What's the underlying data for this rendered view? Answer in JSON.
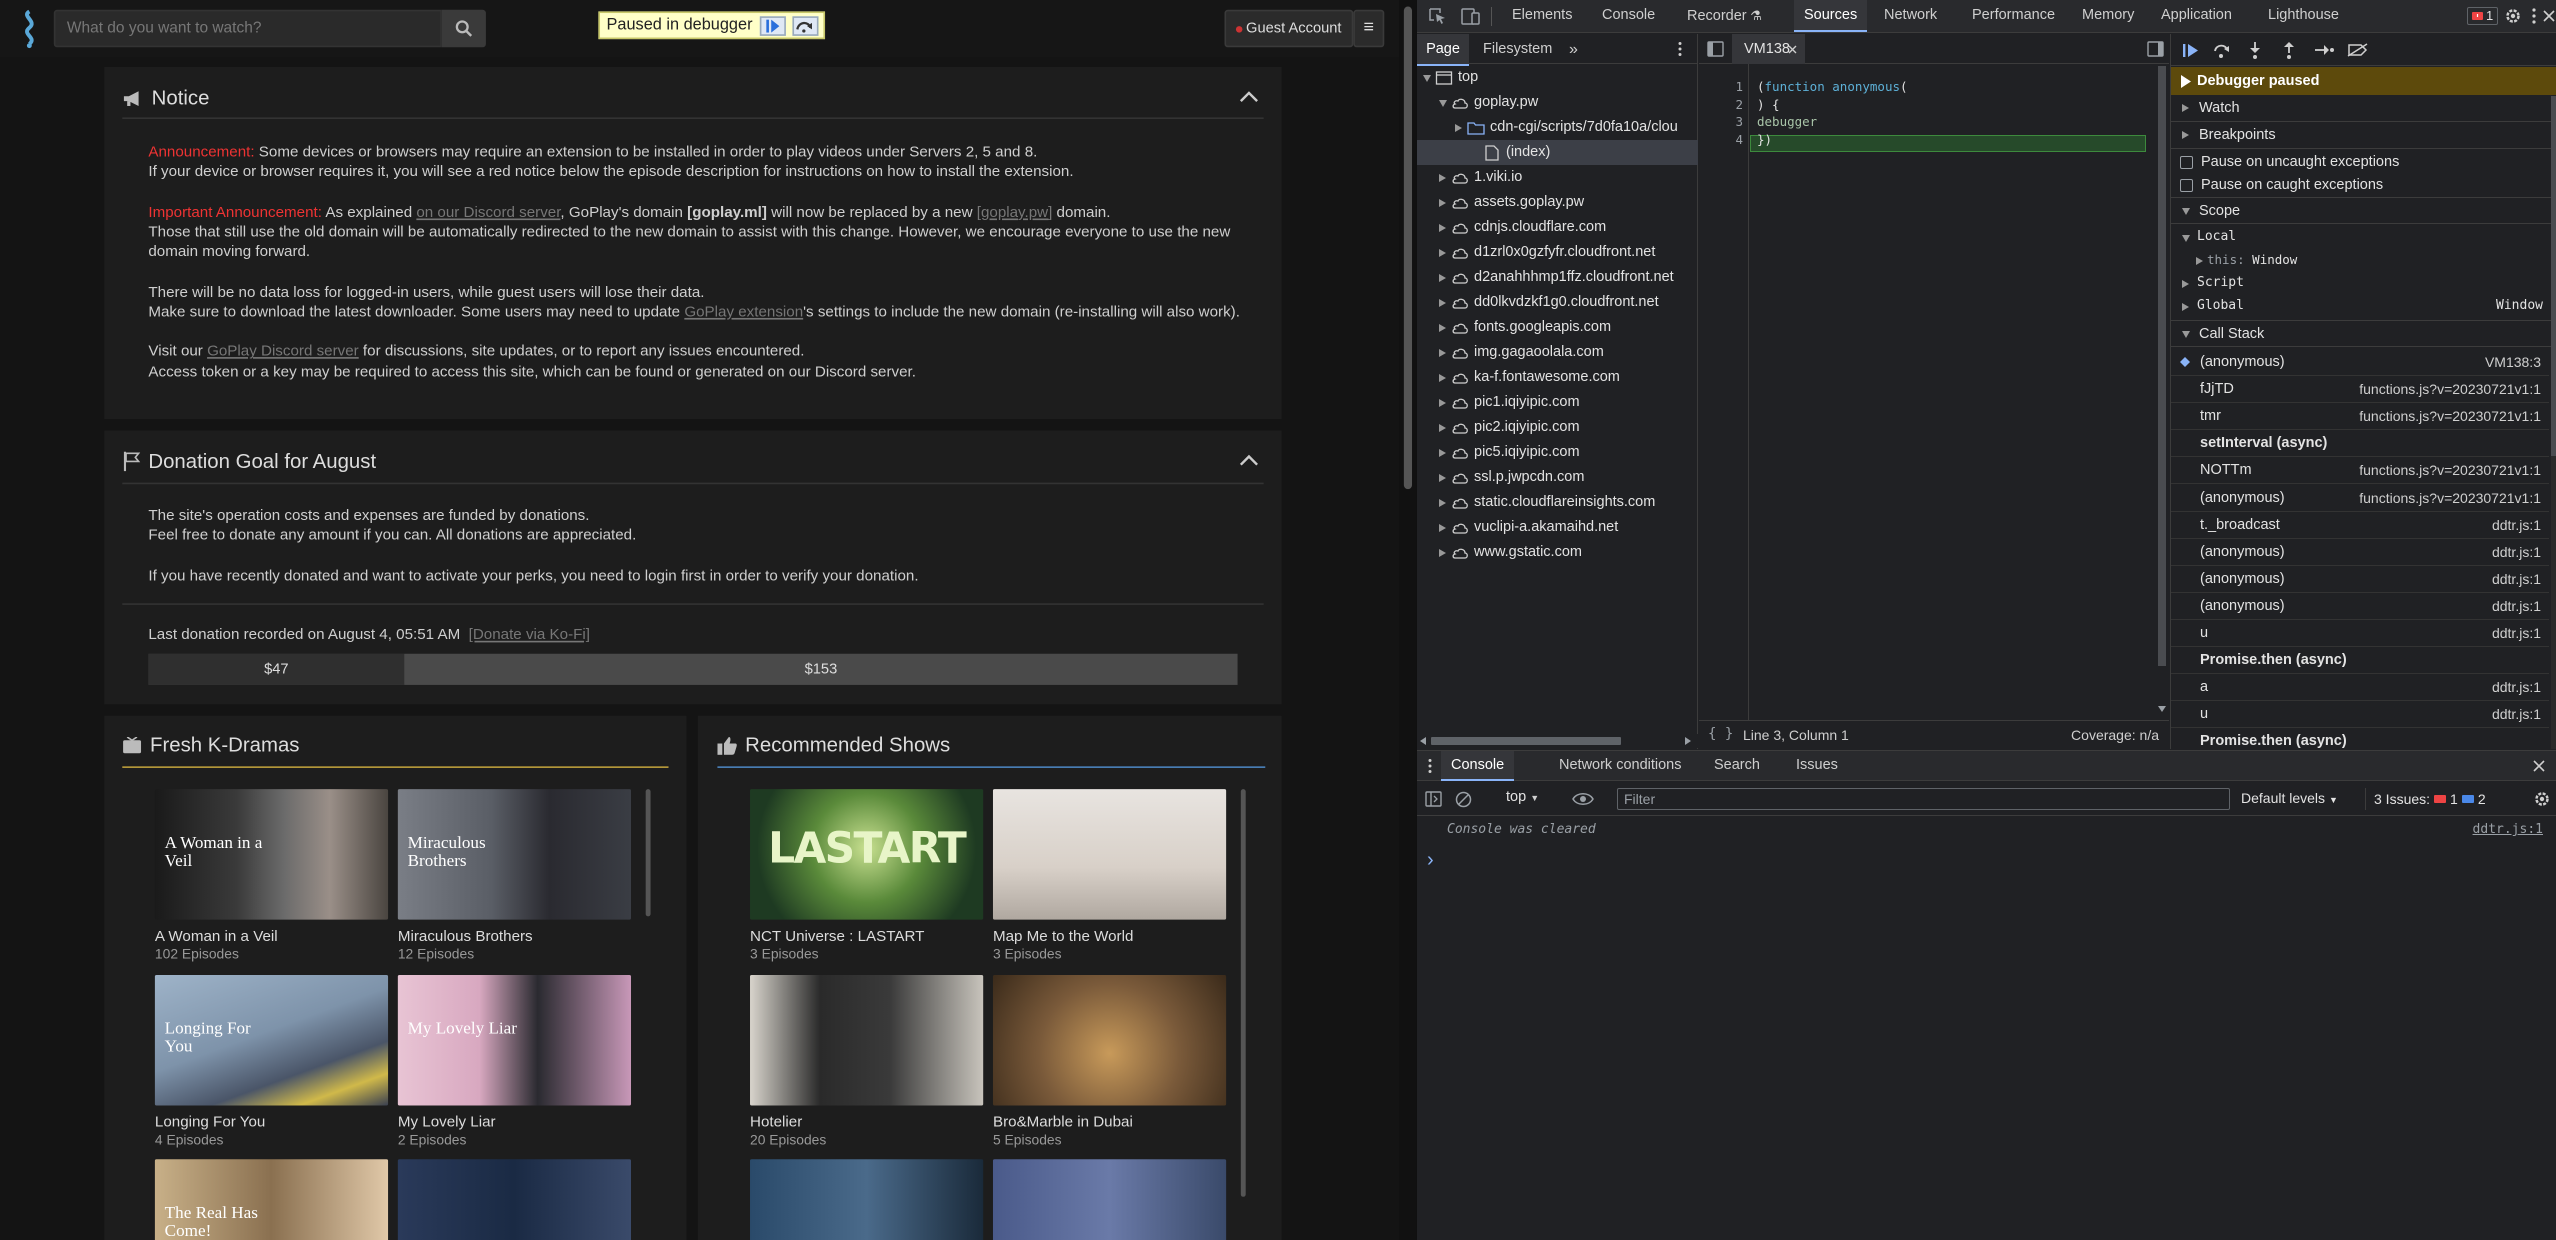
{
  "site": {
    "search_placeholder": "What do you want to watch?",
    "paused_label": "Paused in debugger",
    "guest_label": "Guest Account",
    "notice": {
      "title": "Notice",
      "ann1_label": "Announcement:",
      "ann1_text": " Some devices or browsers may require an extension to be installed in order to play videos under Servers 2, 5 and 8.",
      "ann1_line2": "If your device or browser requires it, you will see a red notice below the episode description for instructions on how to install the extension.",
      "ann2_label": "Important Announcement:",
      "ann2_a": " As explained ",
      "ann2_link": "on our Discord server",
      "ann2_b": ", GoPlay's domain ",
      "ann2_domain_old": "[goplay.ml]",
      "ann2_c": " will now be replaced by a new ",
      "ann2_domain_new": "[goplay.pw]",
      "ann2_d": " domain.",
      "ann2_line2": "Those that still use the old domain will be automatically redirected to the new domain to assist with this change. However, we encourage everyone to use the new domain moving forward.",
      "data_loss": "There will be no data loss for logged-in users, while guest users will lose their data.",
      "dl_a": "Make sure to download the latest downloader. Some users may need to update ",
      "dl_link": "GoPlay extension",
      "dl_b": "'s settings to include the new domain (re-installing will also work).",
      "visit_a": "Visit our ",
      "visit_link": "GoPlay Discord server",
      "visit_b": " for discussions, site updates, or to report any issues encountered.",
      "token": "Access token or a key may be required to access this site, which can be found or generated on our Discord server."
    },
    "donation": {
      "title": "Donation Goal for August",
      "line1": "The site's operation costs and expenses are funded by donations.",
      "line2": "Feel free to donate any amount if you can. All donations are appreciated.",
      "line3": "If you have recently donated and want to activate your perks, you need to login first in order to verify your donation.",
      "last": "Last donation recorded on August 4, 05:51 AM",
      "kofi": "[Donate via Ko-Fi]",
      "raised": "$47",
      "goal": "$153",
      "progress_fraction": 0.235
    },
    "fresh": {
      "title": "Fresh K-Dramas",
      "items": [
        {
          "title": "A Woman in a Veil",
          "eps": "102 Episodes"
        },
        {
          "title": "Miraculous Brothers",
          "eps": "12 Episodes"
        },
        {
          "title": "Longing For You",
          "eps": "4 Episodes"
        },
        {
          "title": "My Lovely Liar",
          "eps": "2 Episodes"
        },
        {
          "title": "",
          "eps": ""
        },
        {
          "title": "",
          "eps": ""
        }
      ],
      "poster_texts": [
        "A Woman in a Veil",
        "Miraculous Brothers",
        "Longing For You",
        "My Lovely Liar",
        "The Real Has Come!",
        ""
      ]
    },
    "recommended": {
      "title": "Recommended Shows",
      "items": [
        {
          "title": "NCT Universe : LASTART",
          "eps": "3 Episodes"
        },
        {
          "title": "Map Me to the World",
          "eps": "3 Episodes"
        },
        {
          "title": "Hotelier",
          "eps": "20 Episodes"
        },
        {
          "title": "Bro&Marble in Dubai",
          "eps": "5 Episodes"
        },
        {
          "title": "",
          "eps": ""
        },
        {
          "title": "",
          "eps": ""
        }
      ],
      "poster_texts": [
        "LASTART",
        "",
        "",
        "",
        "",
        ""
      ]
    }
  },
  "devtools": {
    "tabs": [
      "Elements",
      "Console",
      "Recorder",
      "Sources",
      "Network",
      "Performance",
      "Memory",
      "Application",
      "Lighthouse"
    ],
    "active_tab": "Sources",
    "error_badge": "1",
    "nav_tabs": {
      "page": "Page",
      "filesystem": "Filesystem"
    },
    "tree": [
      {
        "label": "top",
        "depth": 0,
        "icon": "frame",
        "open": true
      },
      {
        "label": "goplay.pw",
        "depth": 1,
        "icon": "cloud",
        "open": true
      },
      {
        "label": "cdn-cgi/scripts/7d0fa10a/clou",
        "depth": 2,
        "icon": "folder",
        "open": false
      },
      {
        "label": "(index)",
        "depth": 3,
        "icon": "file",
        "selected": true
      },
      {
        "label": "1.viki.io",
        "depth": 1,
        "icon": "cloud"
      },
      {
        "label": "assets.goplay.pw",
        "depth": 1,
        "icon": "cloud"
      },
      {
        "label": "cdnjs.cloudflare.com",
        "depth": 1,
        "icon": "cloud"
      },
      {
        "label": "d1zrl0x0gzfyfr.cloudfront.net",
        "depth": 1,
        "icon": "cloud"
      },
      {
        "label": "d2anahhhmp1ffz.cloudfront.net",
        "depth": 1,
        "icon": "cloud"
      },
      {
        "label": "dd0lkvdzkf1g0.cloudfront.net",
        "depth": 1,
        "icon": "cloud"
      },
      {
        "label": "fonts.googleapis.com",
        "depth": 1,
        "icon": "cloud"
      },
      {
        "label": "img.gagaoolala.com",
        "depth": 1,
        "icon": "cloud"
      },
      {
        "label": "ka-f.fontawesome.com",
        "depth": 1,
        "icon": "cloud"
      },
      {
        "label": "pic1.iqiyipic.com",
        "depth": 1,
        "icon": "cloud"
      },
      {
        "label": "pic2.iqiyipic.com",
        "depth": 1,
        "icon": "cloud"
      },
      {
        "label": "pic5.iqiyipic.com",
        "depth": 1,
        "icon": "cloud"
      },
      {
        "label": "ssl.p.jwpcdn.com",
        "depth": 1,
        "icon": "cloud"
      },
      {
        "label": "static.cloudflareinsights.com",
        "depth": 1,
        "icon": "cloud"
      },
      {
        "label": "vuclipi-a.akamaihd.net",
        "depth": 1,
        "icon": "cloud"
      },
      {
        "label": "www.gstatic.com",
        "depth": 1,
        "icon": "cloud"
      }
    ],
    "editor": {
      "tab": "VM138",
      "lines": [
        "1",
        "2",
        "3",
        "4"
      ],
      "code": [
        "(function anonymous(",
        ") {",
        "debugger",
        "})"
      ],
      "status": "Line 3, Column 1",
      "coverage": "Coverage: n/a"
    },
    "debugger": {
      "paused": "Debugger paused",
      "watch": "Watch",
      "breakpoints": "Breakpoints",
      "pause_uncaught": "Pause on uncaught exceptions",
      "pause_caught": "Pause on caught exceptions",
      "scope": "Scope",
      "local": "Local",
      "this_key": "this:",
      "this_val": "Window",
      "script": "Script",
      "global": "Global",
      "global_val": "Window",
      "call_stack": "Call Stack",
      "frames": [
        {
          "name": "(anonymous)",
          "loc": "VM138:3",
          "current": true
        },
        {
          "name": "fJjTD",
          "loc": "functions.js?v=20230721v1:1"
        },
        {
          "name": "tmr",
          "loc": "functions.js?v=20230721v1:1"
        },
        {
          "name": "setInterval (async)",
          "loc": "",
          "async": true
        },
        {
          "name": "NOTTm",
          "loc": "functions.js?v=20230721v1:1"
        },
        {
          "name": "(anonymous)",
          "loc": "functions.js?v=20230721v1:1"
        },
        {
          "name": "t._broadcast",
          "loc": "ddtr.js:1"
        },
        {
          "name": "(anonymous)",
          "loc": "ddtr.js:1"
        },
        {
          "name": "(anonymous)",
          "loc": "ddtr.js:1"
        },
        {
          "name": "(anonymous)",
          "loc": "ddtr.js:1"
        },
        {
          "name": "u",
          "loc": "ddtr.js:1"
        },
        {
          "name": "Promise.then (async)",
          "loc": "",
          "async": true
        },
        {
          "name": "a",
          "loc": "ddtr.js:1"
        },
        {
          "name": "u",
          "loc": "ddtr.js:1"
        },
        {
          "name": "Promise.then (async)",
          "loc": "",
          "async": true
        }
      ]
    },
    "drawer": {
      "tabs": [
        "Console",
        "Network conditions",
        "Search",
        "Issues"
      ],
      "context": "top",
      "filter_placeholder": "Filter",
      "levels": "Default levels",
      "issues_label": "3 Issues:",
      "issues_err": "1",
      "issues_info": "2",
      "cleared": "Console was cleared",
      "cleared_src": "ddtr.js:1",
      "prompt": "›"
    }
  }
}
